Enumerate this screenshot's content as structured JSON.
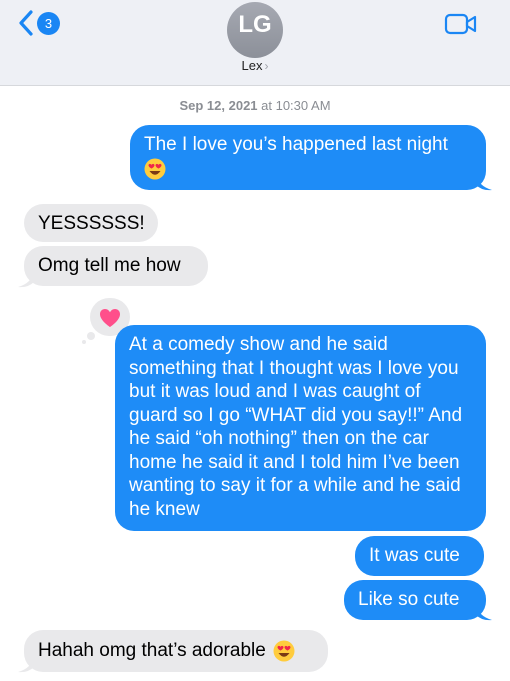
{
  "header": {
    "back_count": "3",
    "avatar_initials": "LG",
    "contact_name": "Lex",
    "contact_chevron": "›",
    "icons": {
      "back": "chevron-left-icon",
      "video": "video-camera-icon"
    }
  },
  "thread": {
    "timestamp_date": "Sep 12, 2021",
    "timestamp_time": " at 10:30 AM",
    "messages": [
      {
        "from": "me",
        "text": "The I love you’s happened last night",
        "emoji": "smiling-face-with-heart-eyes"
      },
      {
        "from": "them",
        "text": "YESSSSSS!"
      },
      {
        "from": "them",
        "text": "Omg tell me how"
      },
      {
        "from": "me",
        "reaction": "heart",
        "text": "At a comedy show and he said something that I thought was I love you but it was loud and I was caught of guard so I go “WHAT did you say!!” And he said “oh nothing” then on the car home he said it and I told him I’ve been wanting to say it for a while and he said he knew"
      },
      {
        "from": "me",
        "text": "It was cute"
      },
      {
        "from": "me",
        "text": "Like so cute"
      },
      {
        "from": "them",
        "text": "Hahah omg that’s adorable",
        "emoji": "smiling-face-with-heart-eyes"
      }
    ]
  },
  "colors": {
    "outgoing_bubble": "#1e8cf7",
    "incoming_bubble": "#e9e9eb",
    "header_bg": "#eef0f5",
    "accent": "#1a86f4",
    "reaction_heart": "#ff4f8b"
  }
}
